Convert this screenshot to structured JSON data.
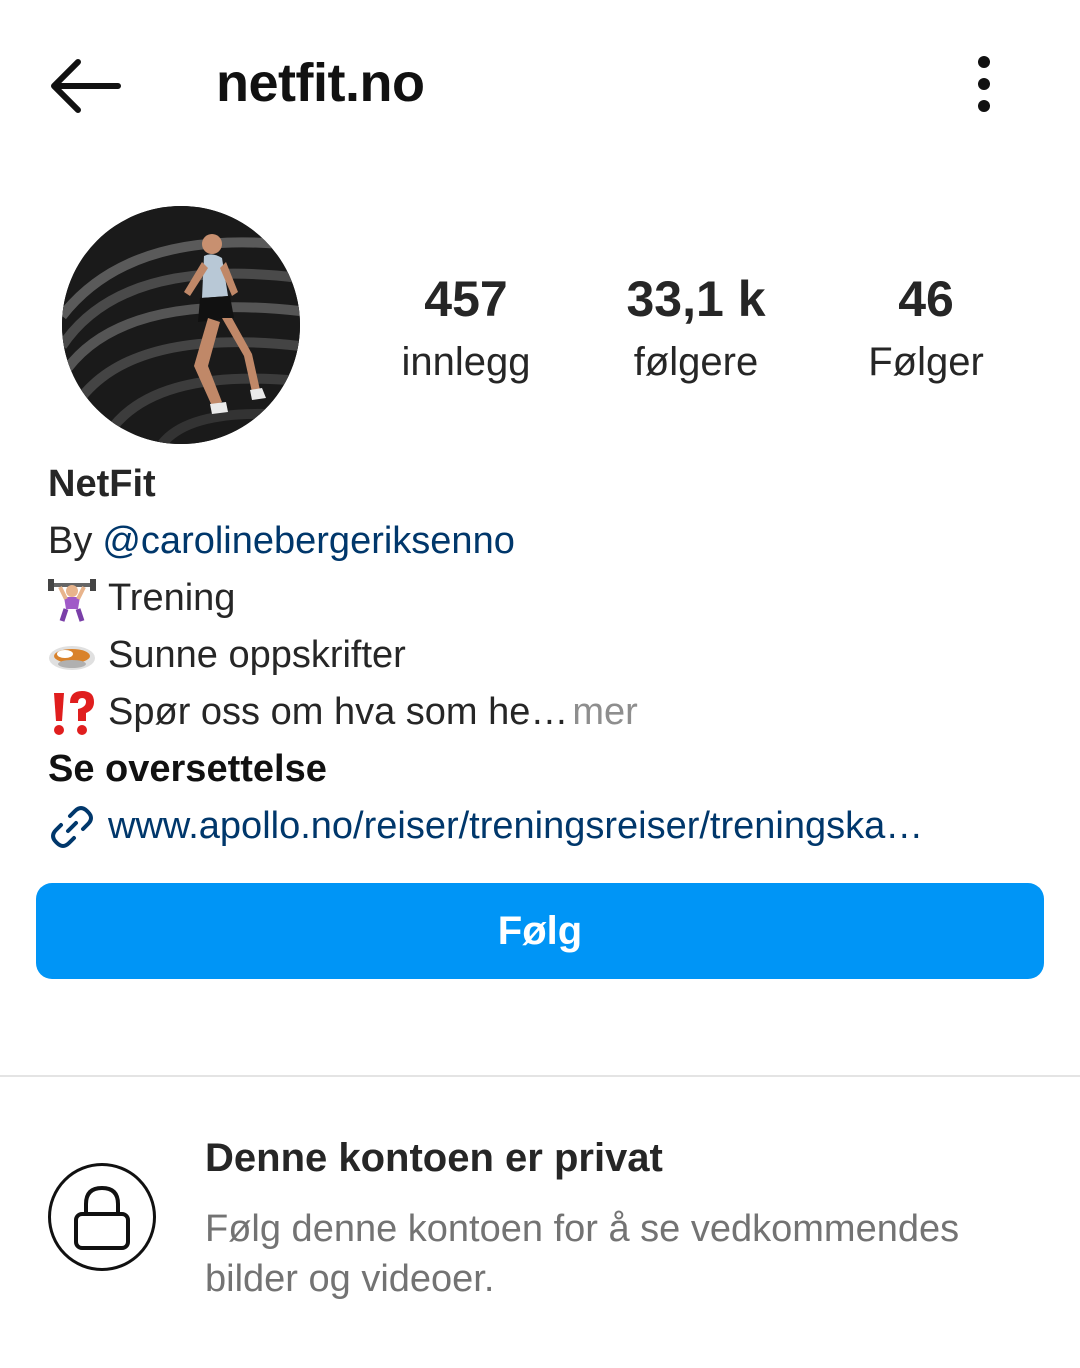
{
  "header": {
    "username": "netfit.no",
    "back_icon": "arrow-left-icon",
    "more_icon": "more-vertical-icon"
  },
  "stats": [
    {
      "value": "457",
      "label": "innlegg"
    },
    {
      "value": "33,1 k",
      "label": "følgere"
    },
    {
      "value": "46",
      "label": "Følger"
    }
  ],
  "bio": {
    "name": "NetFit",
    "by_prefix": "By",
    "mention": "@carolinebergeriksenno",
    "lines": [
      {
        "icon": "weightlifter-emoji",
        "text": "Trening"
      },
      {
        "icon": "curry-bowl-emoji",
        "text": "Sunne oppskrifter"
      },
      {
        "icon": "exclamation-question-emoji",
        "text": "Spør oss om hva som he…"
      }
    ],
    "more_label": "mer",
    "translate_label": "Se oversettelse",
    "link_icon": "link-icon",
    "link": "www.apollo.no/reiser/treningsreiser/treningska…"
  },
  "follow_button": {
    "label": "Følg",
    "color": "#0095f6"
  },
  "private_notice": {
    "icon": "lock-icon",
    "title": "Denne kontoen er privat",
    "subtitle": "Følg denne kontoen for å se vedkommendes bilder og videoer."
  },
  "colors": {
    "link": "#00376b",
    "muted": "#737373"
  }
}
